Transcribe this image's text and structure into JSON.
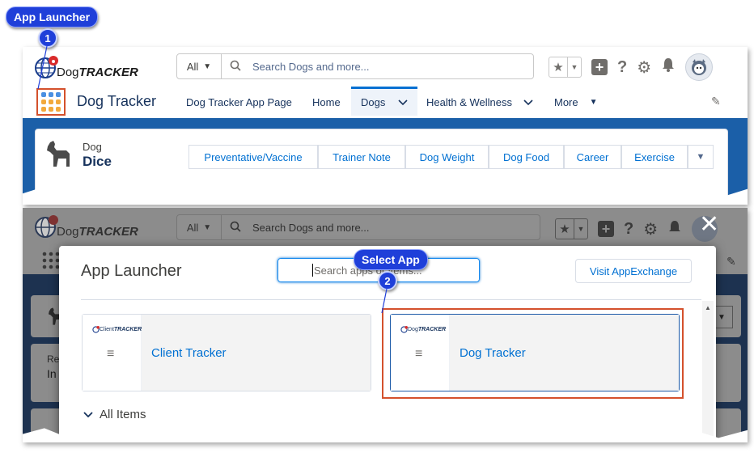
{
  "callouts": {
    "app_launcher": "App Launcher",
    "step1": "1",
    "select_app": "Select App",
    "step2": "2"
  },
  "header": {
    "logo_prefix": "Dog",
    "logo_suffix": "TRACKER",
    "search_scope": "All",
    "search_placeholder": "Search Dogs and more...",
    "app_name": "Dog Tracker"
  },
  "nav": {
    "tabs": [
      {
        "label": "Dog Tracker App Page"
      },
      {
        "label": "Home"
      },
      {
        "label": "Dogs"
      },
      {
        "label": "Health & Wellness"
      },
      {
        "label": "More"
      }
    ]
  },
  "record": {
    "object_label": "Dog",
    "record_name": "Dice",
    "subtabs": [
      "Preventative/Vaccine",
      "Trainer Note",
      "Dog Weight",
      "Dog Food",
      "Career",
      "Exercise"
    ]
  },
  "launcher": {
    "title": "App Launcher",
    "search_placeholder": "Search apps or items...",
    "visit_button": "Visit AppExchange",
    "apps": [
      {
        "name": "Client Tracker",
        "logo_prefix": "Client",
        "logo_suffix": "TRACKER"
      },
      {
        "name": "Dog Tracker",
        "logo_prefix": "Dog",
        "logo_suffix": "TRACKER"
      }
    ],
    "all_items": "All Items"
  },
  "background_fragments": {
    "left_text_1": "Re",
    "left_text_2": "In"
  },
  "colors": {
    "callout_blue": "#1f3fd9",
    "highlight_red": "#d4512c",
    "link_blue": "#0070d2",
    "band_blue": "#1b5fa8"
  }
}
